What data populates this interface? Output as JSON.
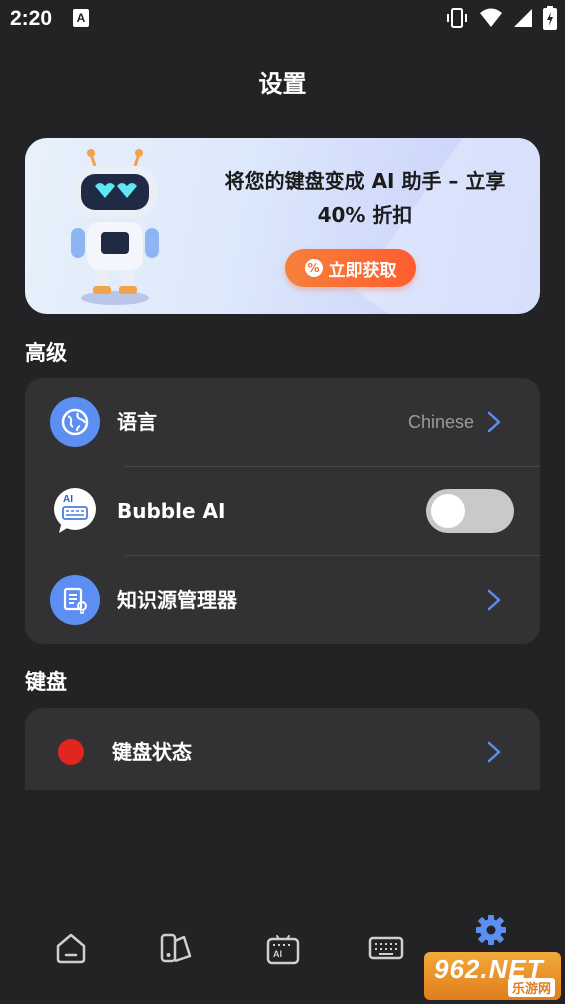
{
  "status_bar": {
    "time": "2:20",
    "notif_letter": "A"
  },
  "page_title": "设置",
  "banner": {
    "line1": "将您的键盘变成 AI 助手 – 立享",
    "line2": "40% 折扣",
    "button_label": "立即获取",
    "button_icon_glyph": "%"
  },
  "advanced": {
    "section_title": "高级",
    "items": [
      {
        "label": "语言",
        "value": "Chinese",
        "icon": "globe-icon"
      },
      {
        "label": "Bubble AI",
        "icon": "bubble-ai-icon",
        "toggle_on": false,
        "badge_text": "AI"
      },
      {
        "label": "知识源管理器",
        "icon": "knowledge-doc-icon"
      }
    ]
  },
  "keyboard": {
    "section_title": "键盘",
    "items": [
      {
        "label": "键盘状态",
        "status_color": "#e0261f"
      }
    ]
  },
  "nav": {
    "items": [
      "home-icon",
      "theme-icon",
      "ai-keyboard-icon",
      "keyboard-icon",
      "settings-icon"
    ],
    "active": "settings-icon",
    "ai_glyph": "AI"
  },
  "watermark": {
    "brand": "962.NET",
    "sub": "乐游网"
  },
  "colors": {
    "accent": "#5d8ef2",
    "background": "#232224",
    "card": "#323134",
    "promo_button": "#ff6a30"
  }
}
